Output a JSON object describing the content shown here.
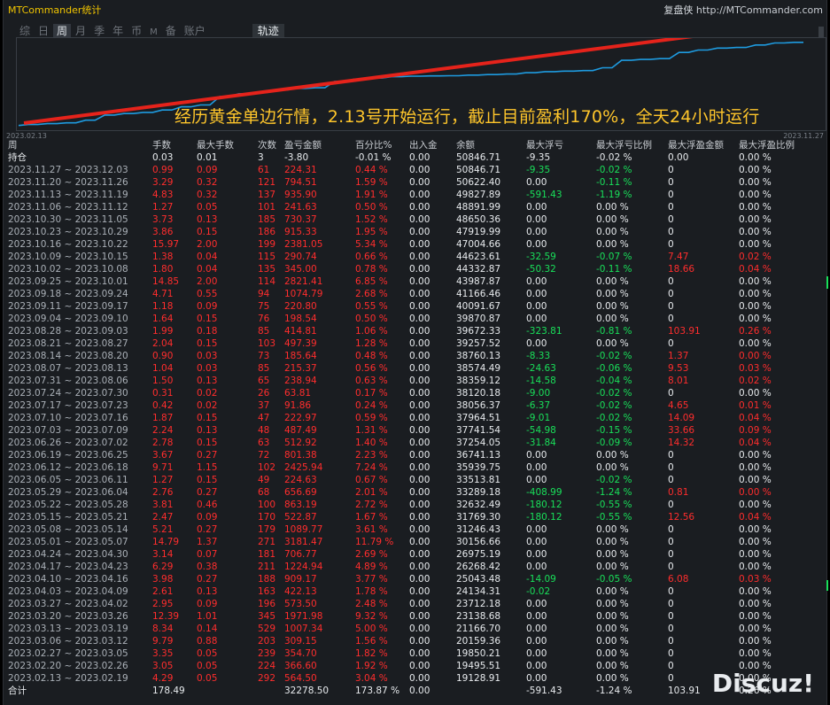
{
  "window": {
    "title": "MTCommander统计",
    "brand_name": "复盘侠",
    "brand_url": "http://MTCommander.com"
  },
  "tabs": [
    {
      "label": "综"
    },
    {
      "label": "日"
    },
    {
      "label": "周",
      "active": true
    },
    {
      "label": "月"
    },
    {
      "label": "季"
    },
    {
      "label": "年"
    },
    {
      "label": "币"
    },
    {
      "label": "M"
    },
    {
      "label": "备"
    },
    {
      "label": "账户"
    },
    {
      "label": "轨迹"
    }
  ],
  "chart": {
    "start_label": "2023.02.13",
    "end_label": "2023.11.27",
    "annotation": "经历黄金单边行情，2.13号开始运行，截止目前盈利170%，全天24小时运行",
    "line_color": "#1e9be0",
    "arrow_color": "#e5231b"
  },
  "chart_data": {
    "type": "line",
    "title": "",
    "xlabel": "",
    "ylabel": "",
    "x_range": [
      "2023.02.13",
      "2023.11.27"
    ],
    "series": [
      {
        "values": [
          19128.91,
          19495.51,
          19850.21,
          20159.36,
          21166.7,
          23138.68,
          23712.18,
          24134.31,
          25043.48,
          26268.42,
          26975.19,
          30156.66,
          31246.43,
          31769.3,
          32632.49,
          33289.18,
          33513.81,
          35939.75,
          36741.13,
          37254.05,
          37741.54,
          37964.51,
          38056.37,
          38120.18,
          38359.12,
          38574.49,
          38760.13,
          39257.52,
          39672.33,
          39870.87,
          40091.67,
          41166.46,
          43987.87,
          44332.87,
          44623.61,
          47004.66,
          47919.99,
          48650.36,
          48891.99,
          49827.89,
          50622.4,
          50846.71
        ]
      }
    ]
  },
  "table": {
    "headers": [
      "周",
      "手数",
      "最大手数",
      "次数",
      "盈亏金额",
      "百分比%",
      "出入金",
      "余额",
      "最大浮亏",
      "最大浮亏比例",
      "最大浮盈金额",
      "最大浮盈比例"
    ],
    "holding": [
      "持仓",
      "0.03",
      "0.01",
      "3",
      "-3.80",
      "-0.01 %",
      "0.00",
      "50846.71",
      "-9.35",
      "-0.02 %",
      "0.00",
      "0.00 %"
    ],
    "rows": [
      [
        "2023.11.27 ~ 2023.12.03",
        "0.99",
        "0.09",
        "61",
        "224.31",
        "0.44 %",
        "0.00",
        "50846.71",
        "-9.35",
        "-0.02 %",
        "0",
        "0.00 %"
      ],
      [
        "2023.11.20 ~ 2023.11.26",
        "3.29",
        "0.32",
        "121",
        "794.51",
        "1.59 %",
        "0.00",
        "50622.40",
        "0.00",
        "-0.11 %",
        "0",
        "0.00 %"
      ],
      [
        "2023.11.13 ~ 2023.11.19",
        "4.83",
        "0.32",
        "137",
        "935.90",
        "1.91 %",
        "0.00",
        "49827.89",
        "-591.43",
        "-1.19 %",
        "0",
        "0.00 %"
      ],
      [
        "2023.11.06 ~ 2023.11.12",
        "1.27",
        "0.05",
        "101",
        "241.63",
        "0.50 %",
        "0.00",
        "48891.99",
        "0.00",
        "0.00 %",
        "0",
        "0.00 %"
      ],
      [
        "2023.10.30 ~ 2023.11.05",
        "3.73",
        "0.13",
        "185",
        "730.37",
        "1.52 %",
        "0.00",
        "48650.36",
        "0.00",
        "0.00 %",
        "0",
        "0.00 %"
      ],
      [
        "2023.10.23 ~ 2023.10.29",
        "3.86",
        "0.15",
        "186",
        "915.33",
        "1.95 %",
        "0.00",
        "47919.99",
        "0.00",
        "0.00 %",
        "0",
        "0.00 %"
      ],
      [
        "2023.10.16 ~ 2023.10.22",
        "15.97",
        "2.00",
        "199",
        "2381.05",
        "5.34 %",
        "0.00",
        "47004.66",
        "0.00",
        "0.00 %",
        "0",
        "0.00 %"
      ],
      [
        "2023.10.09 ~ 2023.10.15",
        "1.38",
        "0.04",
        "115",
        "290.74",
        "0.66 %",
        "0.00",
        "44623.61",
        "-32.59",
        "-0.07 %",
        "7.47",
        "0.02 %"
      ],
      [
        "2023.10.02 ~ 2023.10.08",
        "1.80",
        "0.04",
        "135",
        "345.00",
        "0.78 %",
        "0.00",
        "44332.87",
        "-50.32",
        "-0.11 %",
        "18.66",
        "0.04 %"
      ],
      [
        "2023.09.25 ~ 2023.10.01",
        "14.85",
        "2.00",
        "114",
        "2821.41",
        "6.85 %",
        "0.00",
        "43987.87",
        "0.00",
        "0.00 %",
        "0",
        "0.00 %"
      ],
      [
        "2023.09.18 ~ 2023.09.24",
        "4.71",
        "0.55",
        "94",
        "1074.79",
        "2.68 %",
        "0.00",
        "41166.46",
        "0.00",
        "0.00 %",
        "0",
        "0.00 %"
      ],
      [
        "2023.09.11 ~ 2023.09.17",
        "1.18",
        "0.09",
        "75",
        "220.80",
        "0.55 %",
        "0.00",
        "40091.67",
        "0.00",
        "0.00 %",
        "0",
        "0.00 %"
      ],
      [
        "2023.09.04 ~ 2023.09.10",
        "1.64",
        "0.15",
        "76",
        "198.54",
        "0.50 %",
        "0.00",
        "39870.87",
        "0.00",
        "0.00 %",
        "0",
        "0.00 %"
      ],
      [
        "2023.08.28 ~ 2023.09.03",
        "1.99",
        "0.18",
        "85",
        "414.81",
        "1.06 %",
        "0.00",
        "39672.33",
        "-323.81",
        "-0.81 %",
        "103.91",
        "0.26 %"
      ],
      [
        "2023.08.21 ~ 2023.08.27",
        "2.04",
        "0.15",
        "103",
        "497.39",
        "1.28 %",
        "0.00",
        "39257.52",
        "0.00",
        "0.00 %",
        "0",
        "0.00 %"
      ],
      [
        "2023.08.14 ~ 2023.08.20",
        "0.90",
        "0.03",
        "73",
        "185.64",
        "0.48 %",
        "0.00",
        "38760.13",
        "-8.33",
        "-0.02 %",
        "1.37",
        "0.00 %"
      ],
      [
        "2023.08.07 ~ 2023.08.13",
        "1.04",
        "0.03",
        "85",
        "215.37",
        "0.56 %",
        "0.00",
        "38574.49",
        "-24.63",
        "-0.06 %",
        "9.53",
        "0.03 %"
      ],
      [
        "2023.07.31 ~ 2023.08.06",
        "1.50",
        "0.13",
        "65",
        "238.94",
        "0.63 %",
        "0.00",
        "38359.12",
        "-14.58",
        "-0.04 %",
        "8.01",
        "0.02 %"
      ],
      [
        "2023.07.24 ~ 2023.07.30",
        "0.31",
        "0.02",
        "26",
        "63.81",
        "0.17 %",
        "0.00",
        "38120.18",
        "-9.00",
        "-0.02 %",
        "0",
        "0.00 %"
      ],
      [
        "2023.07.17 ~ 2023.07.23",
        "0.42",
        "0.02",
        "37",
        "91.86",
        "0.24 %",
        "0.00",
        "38056.37",
        "-6.37",
        "-0.02 %",
        "4.65",
        "0.01 %"
      ],
      [
        "2023.07.10 ~ 2023.07.16",
        "1.87",
        "0.15",
        "47",
        "222.97",
        "0.59 %",
        "0.00",
        "37964.51",
        "-9.01",
        "-0.02 %",
        "14.09",
        "0.04 %"
      ],
      [
        "2023.07.03 ~ 2023.07.09",
        "2.24",
        "0.13",
        "48",
        "487.49",
        "1.31 %",
        "0.00",
        "37741.54",
        "-54.98",
        "-0.15 %",
        "33.66",
        "0.09 %"
      ],
      [
        "2023.06.26 ~ 2023.07.02",
        "2.78",
        "0.15",
        "63",
        "512.92",
        "1.40 %",
        "0.00",
        "37254.05",
        "-31.84",
        "-0.09 %",
        "14.32",
        "0.04 %"
      ],
      [
        "2023.06.19 ~ 2023.06.25",
        "3.67",
        "0.27",
        "72",
        "801.38",
        "2.23 %",
        "0.00",
        "36741.13",
        "0.00",
        "0.00 %",
        "0",
        "0.00 %"
      ],
      [
        "2023.06.12 ~ 2023.06.18",
        "9.71",
        "1.15",
        "102",
        "2425.94",
        "7.24 %",
        "0.00",
        "35939.75",
        "0.00",
        "0.00 %",
        "0",
        "0.00 %"
      ],
      [
        "2023.06.05 ~ 2023.06.11",
        "1.27",
        "0.15",
        "49",
        "224.63",
        "0.67 %",
        "0.00",
        "33513.81",
        "0.00",
        "-0.02 %",
        "0",
        "0.00 %"
      ],
      [
        "2023.05.29 ~ 2023.06.04",
        "2.76",
        "0.27",
        "68",
        "656.69",
        "2.01 %",
        "0.00",
        "33289.18",
        "-408.99",
        "-1.24 %",
        "0.81",
        "0.00 %"
      ],
      [
        "2023.05.22 ~ 2023.05.28",
        "3.81",
        "0.46",
        "100",
        "863.19",
        "2.72 %",
        "0.00",
        "32632.49",
        "-180.12",
        "-0.55 %",
        "0",
        "0.00 %"
      ],
      [
        "2023.05.15 ~ 2023.05.21",
        "2.47",
        "0.09",
        "170",
        "522.87",
        "1.67 %",
        "0.00",
        "31769.30",
        "-180.12",
        "-0.55 %",
        "12.56",
        "0.04 %"
      ],
      [
        "2023.05.08 ~ 2023.05.14",
        "5.21",
        "0.27",
        "179",
        "1089.77",
        "3.61 %",
        "0.00",
        "31246.43",
        "0.00",
        "0.00 %",
        "0",
        "0.00 %"
      ],
      [
        "2023.05.01 ~ 2023.05.07",
        "14.79",
        "1.37",
        "271",
        "3181.47",
        "11.79 %",
        "0.00",
        "30156.66",
        "0.00",
        "0.00 %",
        "0",
        "0.00 %"
      ],
      [
        "2023.04.24 ~ 2023.04.30",
        "3.14",
        "0.07",
        "181",
        "706.77",
        "2.69 %",
        "0.00",
        "26975.19",
        "0.00",
        "0.00 %",
        "0",
        "0.00 %"
      ],
      [
        "2023.04.17 ~ 2023.04.23",
        "6.29",
        "0.38",
        "211",
        "1224.94",
        "4.89 %",
        "0.00",
        "26268.42",
        "0.00",
        "0.00 %",
        "0",
        "0.00 %"
      ],
      [
        "2023.04.10 ~ 2023.04.16",
        "3.98",
        "0.27",
        "188",
        "909.17",
        "3.77 %",
        "0.00",
        "25043.48",
        "-14.09",
        "-0.05 %",
        "6.08",
        "0.03 %"
      ],
      [
        "2023.04.03 ~ 2023.04.09",
        "2.61",
        "0.13",
        "163",
        "422.13",
        "1.78 %",
        "0.00",
        "24134.31",
        "-0.02",
        "0.00 %",
        "0",
        "0.00 %"
      ],
      [
        "2023.03.27 ~ 2023.04.02",
        "2.95",
        "0.09",
        "196",
        "573.50",
        "2.48 %",
        "0.00",
        "23712.18",
        "0.00",
        "0.00 %",
        "0",
        "0.00 %"
      ],
      [
        "2023.03.20 ~ 2023.03.26",
        "12.39",
        "1.01",
        "345",
        "1971.98",
        "9.32 %",
        "0.00",
        "23138.68",
        "0.00",
        "0.00 %",
        "0",
        "0.00 %"
      ],
      [
        "2023.03.13 ~ 2023.03.19",
        "8.34",
        "0.14",
        "529",
        "1007.34",
        "5.00 %",
        "0.00",
        "21166.70",
        "0.00",
        "0.00 %",
        "0",
        "0.00 %"
      ],
      [
        "2023.03.06 ~ 2023.03.12",
        "9.79",
        "0.88",
        "203",
        "309.15",
        "1.56 %",
        "0.00",
        "20159.36",
        "0.00",
        "0.00 %",
        "0",
        "0.00 %"
      ],
      [
        "2023.02.27 ~ 2023.03.05",
        "3.35",
        "0.05",
        "239",
        "354.70",
        "1.82 %",
        "0.00",
        "19850.21",
        "0.00",
        "0.00 %",
        "0",
        "0.00 %"
      ],
      [
        "2023.02.20 ~ 2023.02.26",
        "3.05",
        "0.05",
        "224",
        "366.60",
        "1.92 %",
        "0.00",
        "19495.51",
        "0.00",
        "0.00 %",
        "0",
        "0.00 %"
      ],
      [
        "2023.02.13 ~ 2023.02.19",
        "4.29",
        "0.05",
        "292",
        "564.50",
        "3.04 %",
        "0.00",
        "19128.91",
        "0.00",
        "0.00 %",
        "0",
        "0.00 %"
      ]
    ],
    "total": [
      "合计",
      "178.49",
      "",
      "",
      "32278.50",
      "173.87 %",
      "0.00",
      "",
      "-591.43",
      "-1.24 %",
      "103.91",
      "0.26 %"
    ]
  },
  "watermark": "Discuz!"
}
